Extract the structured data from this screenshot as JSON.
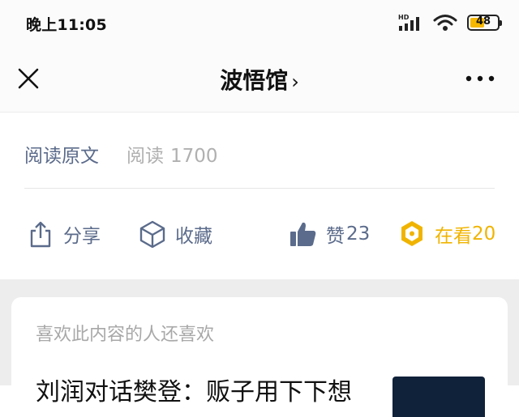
{
  "status_bar": {
    "time": "晚上11:05",
    "signal_label": "HD",
    "battery_level": "48"
  },
  "nav": {
    "title": "波悟馆",
    "title_chevron": "›"
  },
  "article_meta": {
    "read_original": "阅读原文",
    "read_label": "阅读",
    "read_count": "1700"
  },
  "actions": {
    "share": "分享",
    "favorite": "收藏",
    "like_label": "赞",
    "like_count": "23",
    "watching_label": "在看",
    "watching_count": "20"
  },
  "recommend": {
    "heading": "喜欢此内容的人还喜欢",
    "first_title": "刘润对话樊登：贩子用下下想"
  },
  "colors": {
    "accent_blue": "#5b6b8b",
    "accent_gold": "#f0b400",
    "page_gray": "#ededed"
  }
}
